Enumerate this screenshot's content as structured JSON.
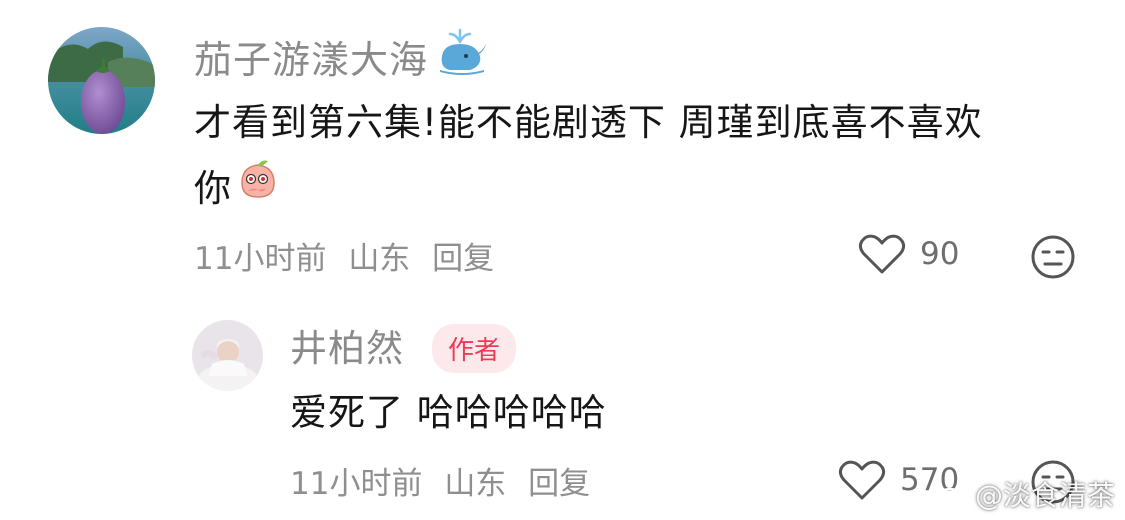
{
  "comments": [
    {
      "username": "茄子游漾大海",
      "username_emoji": "spouting-whale-icon",
      "text_line1": "才看到第六集!能不能剧透下 周瑾到底喜不喜欢",
      "text_line2": "你",
      "text_emoji": "peach-face-icon",
      "time": "11小时前",
      "location": "山东",
      "reply_label": "回复",
      "likes": "90"
    }
  ],
  "reply": {
    "username": "井柏然",
    "badge": "作者",
    "text": "爱死了 哈哈哈哈哈",
    "time": "11小时前",
    "location": "山东",
    "reply_label": "回复",
    "likes": "570"
  },
  "watermark": "@淡食清茶",
  "colors": {
    "username": "#8a8a8a",
    "text": "#161616",
    "meta": "#8f8f8f",
    "badge_bg": "#fde9ec",
    "badge_text": "#ef3a57"
  }
}
